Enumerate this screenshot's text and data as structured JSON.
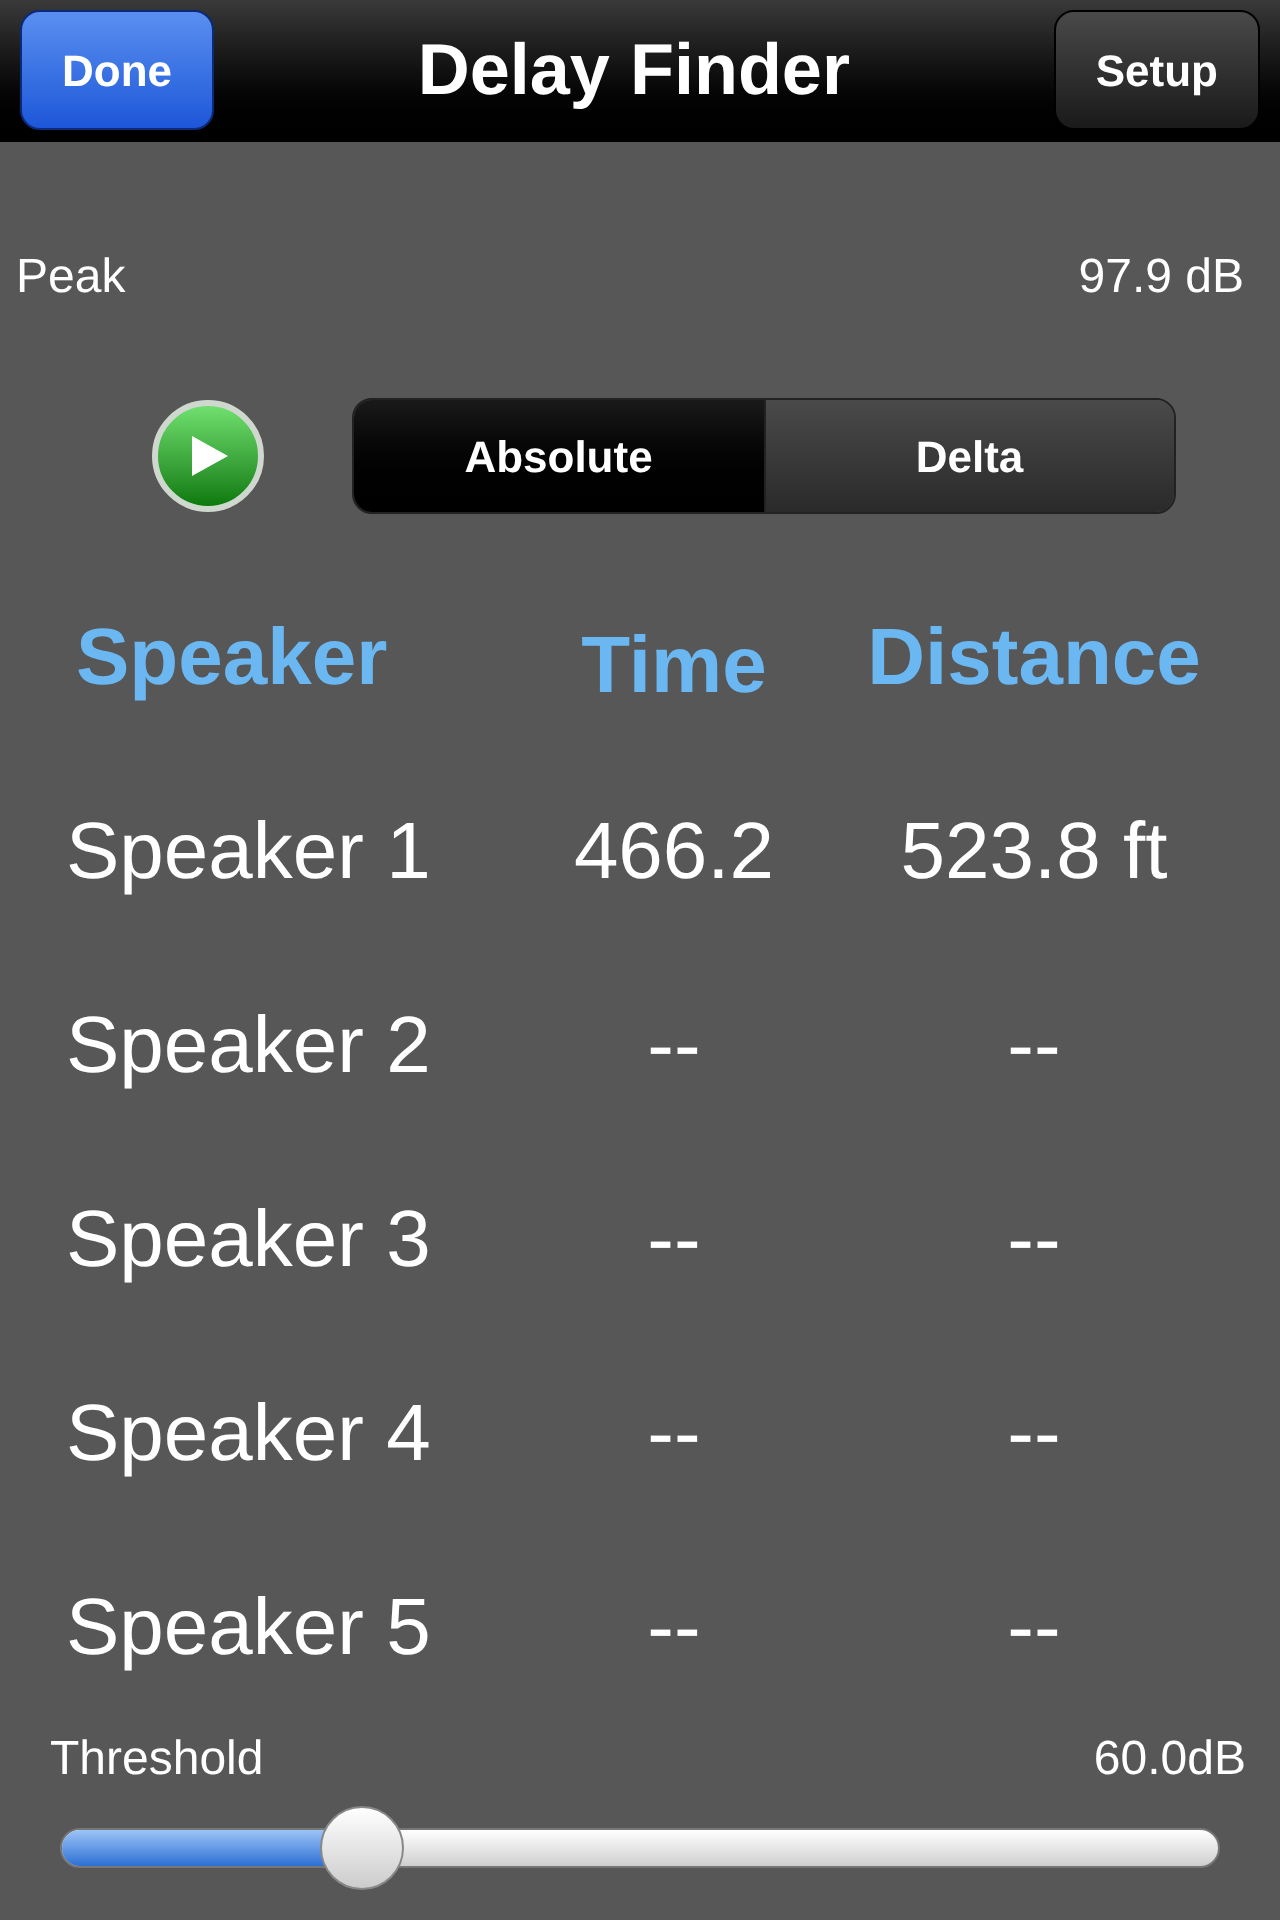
{
  "nav_bar": {
    "title": "Delay Finder",
    "left_button": "Done",
    "right_button": "Setup"
  },
  "peak": {
    "label": "Peak",
    "value": "97.9 dB"
  },
  "play_button": {
    "on": true
  },
  "mode_tabs": [
    {
      "label": "Absolute",
      "selected": true
    },
    {
      "label": "Delta",
      "selected": false
    }
  ],
  "table": {
    "columns": [
      "Speaker",
      "Time",
      "Distance"
    ],
    "rows": [
      [
        "Speaker 1",
        "466.2",
        "523.8 ft"
      ],
      [
        "Speaker 2",
        "--",
        "--"
      ],
      [
        "Speaker 3",
        "--",
        "--"
      ],
      [
        "Speaker 4",
        "--",
        "--"
      ],
      [
        "Speaker 5",
        "--",
        "--"
      ]
    ]
  },
  "threshold": {
    "label": "Threshold",
    "reading": "60.0dB",
    "level": 0.26
  }
}
